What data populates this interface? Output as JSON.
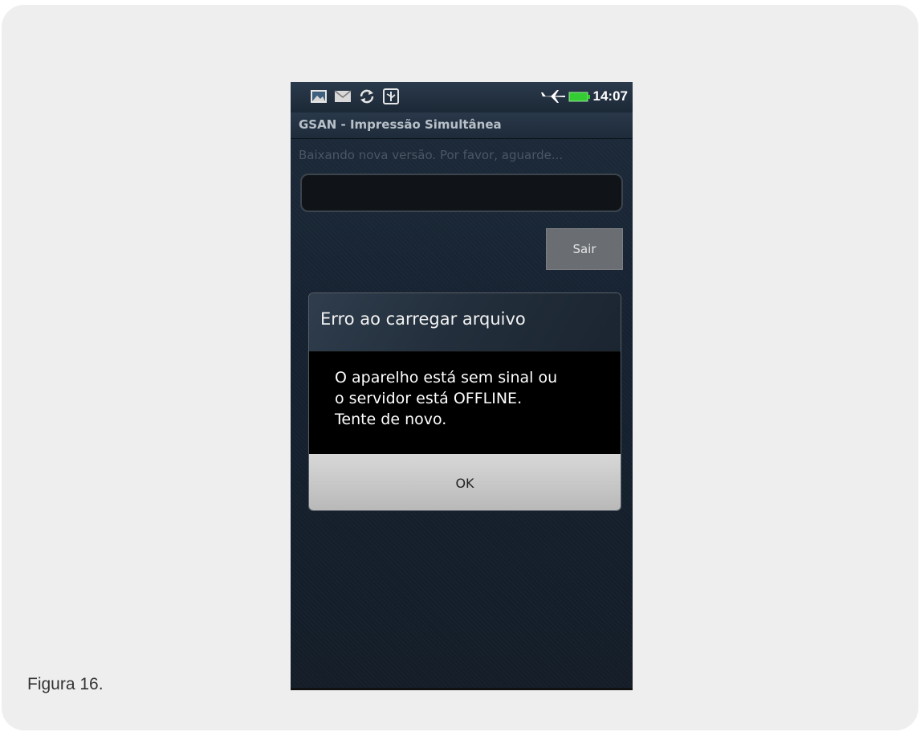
{
  "status_bar": {
    "time": "14:07",
    "icons": [
      "image-icon",
      "mail-icon",
      "sync-icon",
      "usb-icon",
      "airplane-icon",
      "battery-icon"
    ],
    "battery_color": "#33cc33"
  },
  "app": {
    "title": "GSAN - Impressão Simultânea",
    "status_text": "Baixando nova versão. Por favor, aguarde...",
    "exit_button": "Sair"
  },
  "dialog": {
    "title": "Erro ao carregar arquivo",
    "message": "O aparelho está sem sinal ou\no servidor está OFFLINE.\nTente de novo.",
    "ok_button": "OK"
  },
  "caption": "Figura 16."
}
